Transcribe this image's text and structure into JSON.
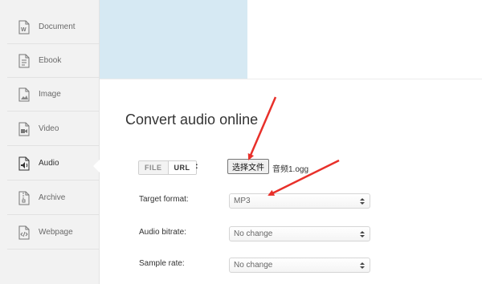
{
  "sidebar": {
    "items": [
      {
        "label": "Document",
        "icon": "document-icon"
      },
      {
        "label": "Ebook",
        "icon": "ebook-icon"
      },
      {
        "label": "Image",
        "icon": "image-icon"
      },
      {
        "label": "Video",
        "icon": "video-icon"
      },
      {
        "label": "Audio",
        "icon": "audio-icon",
        "active": true
      },
      {
        "label": "Archive",
        "icon": "archive-icon"
      },
      {
        "label": "Webpage",
        "icon": "webpage-icon"
      }
    ]
  },
  "main": {
    "title": "Convert audio online",
    "source": {
      "file_tab": "FILE",
      "url_tab": "URL",
      "colon": ":",
      "choose_button": "选择文件",
      "file_name": "音频1.ogg"
    },
    "fields": [
      {
        "label": "Target format:",
        "value": "MP3"
      },
      {
        "label": "Audio bitrate:",
        "value": "No change"
      },
      {
        "label": "Sample rate:",
        "value": "No change"
      }
    ]
  },
  "colors": {
    "banner": "#d6e9f3",
    "sidebar": "#f2f2f2",
    "annotation_arrow": "#e8302a"
  }
}
